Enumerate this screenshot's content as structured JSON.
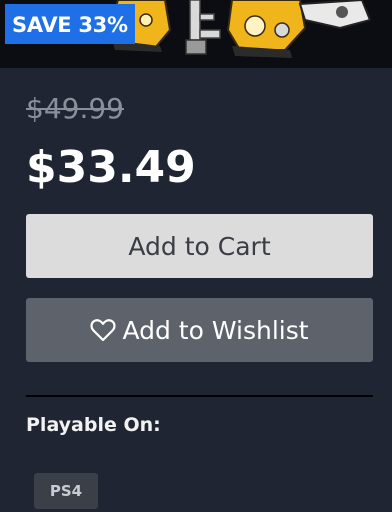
{
  "hero": {
    "badge": "SAVE 33%"
  },
  "pricing": {
    "original": "$49.99",
    "current": "$33.49"
  },
  "actions": {
    "add_to_cart": "Add to Cart",
    "add_to_wishlist": "Add to Wishlist"
  },
  "playable": {
    "label": "Playable On:",
    "platforms": [
      "PS4"
    ]
  },
  "colors": {
    "badge": "#1f6fe6",
    "background": "#1f2532",
    "cart_button": "#dcdcdc",
    "wishlist_button": "#5d626b"
  }
}
